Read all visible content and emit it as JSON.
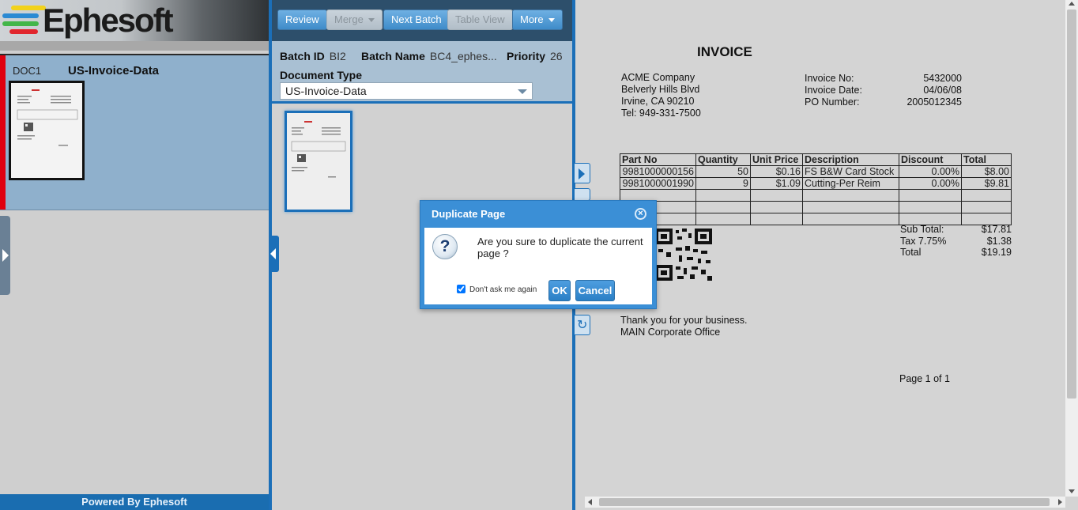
{
  "app": {
    "logo_text": "Ephesoft",
    "footer": "Powered By Ephesoft"
  },
  "documents": [
    {
      "id": "DOC1",
      "type": "US-Invoice-Data"
    }
  ],
  "toolbar": {
    "review": "Review",
    "merge": "Merge",
    "next_batch": "Next Batch",
    "table_view": "Table View",
    "more": "More"
  },
  "batch": {
    "id_label": "Batch ID",
    "id_value": "BI2",
    "name_label": "Batch Name",
    "name_value": "BC4_ephes...",
    "priority_label": "Priority",
    "priority_value": "26",
    "doc_type_label": "Document Type",
    "doc_type_value": "US-Invoice-Data"
  },
  "invoice": {
    "title": "INVOICE",
    "company": [
      "ACME Company",
      "Belverly Hills Blvd",
      "Irvine, CA 90210",
      "Tel: 949-331-7500"
    ],
    "meta": [
      {
        "label": "Invoice No:",
        "value": "5432000"
      },
      {
        "label": "Invoice Date:",
        "value": "04/06/08"
      },
      {
        "label": "PO Number:",
        "value": "2005012345"
      }
    ],
    "table_headers": [
      "Part No",
      "Quantity",
      "Unit Price",
      "Description",
      "Discount",
      "Total"
    ],
    "rows": [
      [
        "9981000000156",
        "50",
        "$0.16",
        "FS B&W Card Stock",
        "0.00%",
        "$8.00"
      ],
      [
        "9981000001990",
        "9",
        "$1.09",
        "Cutting-Per Reim",
        "0.00%",
        "$9.81"
      ]
    ],
    "totals": [
      {
        "label": "Sub Total:",
        "value": "$17.81"
      },
      {
        "label": "Tax 7.75%",
        "value": "$1.38"
      },
      {
        "label": "Total",
        "value": "$19.19"
      }
    ],
    "footer_lines": [
      "Thank you for your business.",
      "MAIN Corporate Office"
    ],
    "page_label": "Page 1 of 1"
  },
  "dialog": {
    "title": "Duplicate Page",
    "message": "Are you sure to duplicate the current page ?",
    "dont_ask": "Don't ask me again",
    "dont_ask_checked": true,
    "ok": "OK",
    "cancel": "Cancel",
    "close_glyph": "×",
    "icon_glyph": "?"
  },
  "colors": {
    "accent": "#1b6fb8",
    "toolbar": "#2d4f6b",
    "doc_selected": "#8fb0cc",
    "doc_marker": "#e0000f"
  },
  "icons": [
    "question-icon",
    "close-icon",
    "rotate-icon",
    "expand-arrow-icon",
    "collapse-arrow-icon",
    "caret-down-icon"
  ]
}
